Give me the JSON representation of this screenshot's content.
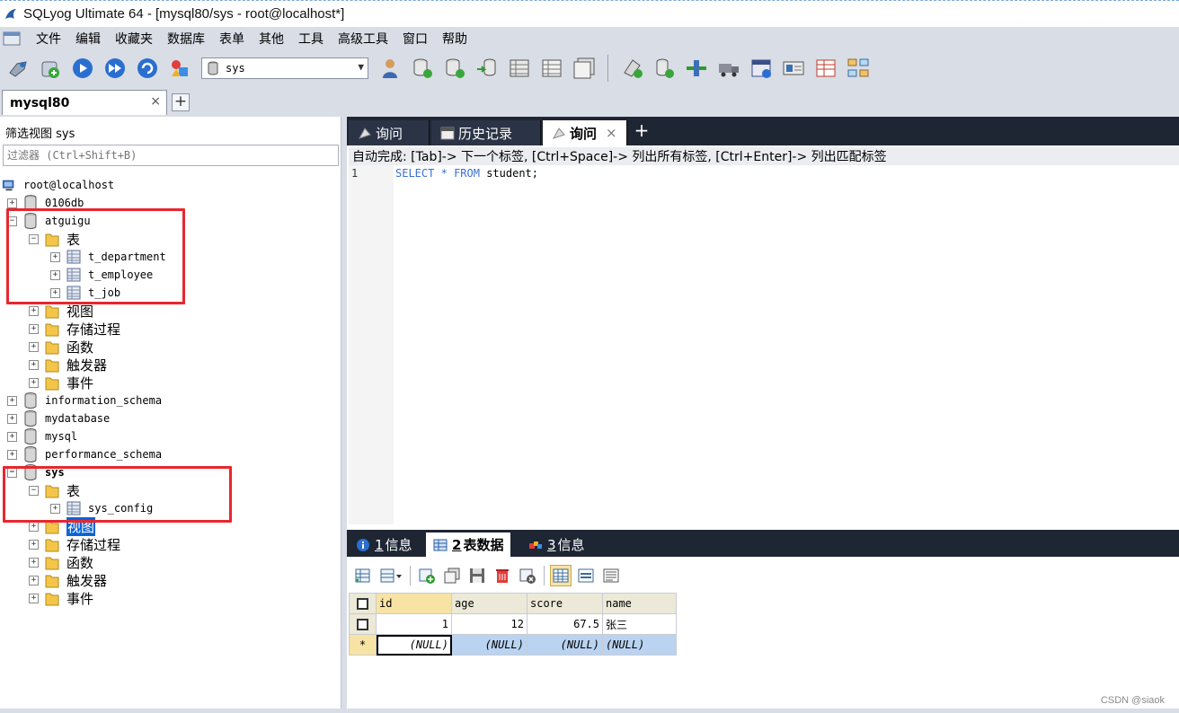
{
  "window": {
    "title": "SQLyog Ultimate 64 - [mysql80/sys - root@localhost*]"
  },
  "menu": [
    "文件",
    "编辑",
    "收藏夹",
    "数据库",
    "表单",
    "其他",
    "工具",
    "高级工具",
    "窗口",
    "帮助"
  ],
  "toolbar": {
    "database_selected": "sys"
  },
  "connection_tab": {
    "label": "mysql80",
    "close": "×",
    "add": "+"
  },
  "left_panel": {
    "filter_label": "筛选视图 sys",
    "filter_placeholder": "过滤器 (Ctrl+Shift+B)",
    "tree": {
      "root": "root@localhost",
      "db_0106": "0106db",
      "atguigu": "atguigu",
      "tables_folder": "表",
      "t_department": "t_department",
      "t_employee": "t_employee",
      "t_job": "t_job",
      "views": "视图",
      "procedures": "存储过程",
      "functions": "函数",
      "triggers": "触发器",
      "events": "事件",
      "information_schema": "information_schema",
      "mydatabase": "mydatabase",
      "mysql": "mysql",
      "performance_schema": "performance_schema",
      "sys": "sys",
      "sys_config": "sys_config"
    }
  },
  "query_tabs": [
    {
      "label": "询问"
    },
    {
      "label": "历史记录"
    },
    {
      "label": "询问",
      "close": "×"
    }
  ],
  "query_tab_add": "+",
  "autocomplete_hint": "自动完成:  [Tab]-> 下一个标签, [Ctrl+Space]-> 列出所有标签, [Ctrl+Enter]-> 列出匹配标签",
  "editor": {
    "line_number": "1",
    "sql_keyword_select": "SELECT",
    "sql_star": "*",
    "sql_keyword_from": "FROM",
    "sql_rest": "student;"
  },
  "result_tabs": [
    {
      "num": "1",
      "label": "信息"
    },
    {
      "num": "2",
      "label": "表数据"
    },
    {
      "num": "3",
      "label": "信息"
    }
  ],
  "grid": {
    "columns": [
      "id",
      "age",
      "score",
      "name"
    ],
    "rows": [
      [
        "1",
        "12",
        "67.5",
        "张三"
      ]
    ],
    "new_row": {
      "marker": "*",
      "values": [
        "(NULL)",
        "(NULL)",
        "(NULL)",
        "(NULL)"
      ]
    }
  },
  "watermark": "CSDN @siaok",
  "colors": {
    "highlight_box": "#e8262e",
    "selection": "#0a64d6",
    "dark_tabbar": "#1e2533"
  }
}
